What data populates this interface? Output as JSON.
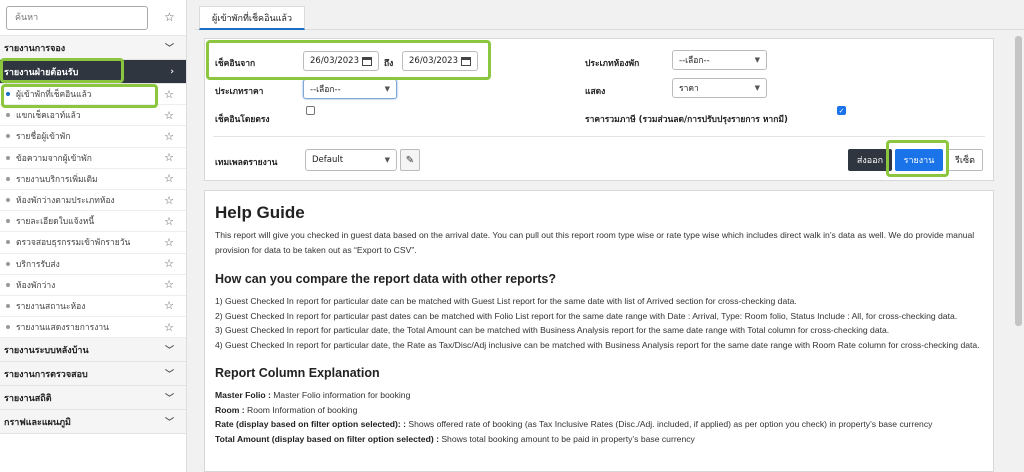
{
  "search": {
    "placeholder": "ค้นหา"
  },
  "sidebar": {
    "sections_top": [
      {
        "label": "รายงานการจอง"
      },
      {
        "label": "รายงานฝ่ายต้อนรับ"
      }
    ],
    "items": [
      {
        "label": "ผู้เข้าพักที่เช็คอินแล้ว"
      },
      {
        "label": "แขกเช็คเอาท์แล้ว"
      },
      {
        "label": "รายชื่อผู้เข้าพัก"
      },
      {
        "label": "ข้อความจากผู้เข้าพัก"
      },
      {
        "label": "รายงานบริการเพิ่มเติม"
      },
      {
        "label": "ห้องพักว่างตามประเภทห้อง"
      },
      {
        "label": "รายละเอียดใบแจ้งหนี้"
      },
      {
        "label": "ตรวจสอบธุรกรรมเข้าพักรายวัน"
      },
      {
        "label": "บริการรับส่ง"
      },
      {
        "label": "ห้องพักว่าง"
      },
      {
        "label": "รายงานสถานะห้อง"
      },
      {
        "label": "รายงานแสดงรายการงาน"
      }
    ],
    "sections_bottom": [
      {
        "label": "รายงานระบบหลังบ้าน"
      },
      {
        "label": "รายงานการตรวจสอบ"
      },
      {
        "label": "รายงานสถิติ"
      },
      {
        "label": "กราฟและแผนภูมิ"
      }
    ]
  },
  "tab": {
    "label": "ผู้เข้าพักที่เช็คอินแล้ว"
  },
  "filters": {
    "checkin_from_label": "เช็คอินจาก",
    "date_from": "26/03/2023",
    "to_label": "ถึง",
    "date_to": "26/03/2023",
    "room_type_label": "ประเภทห้องพัก",
    "room_type_value": "--เลือก--",
    "rate_type_label": "ประเภทราคา",
    "rate_type_value": "--เลือก--",
    "show_label": "แสดง",
    "show_value": "ราคา",
    "direct_checkin_label": "เช็คอินโดยตรง",
    "direct_checkin_checked": false,
    "tax_inclusive_label": "ราคารวมภาษี (รวมส่วนลด/การปรับปรุงรายการ หากมี)",
    "tax_inclusive_checked": true,
    "template_label": "เทมเพลตรายงาน",
    "template_value": "Default"
  },
  "buttons": {
    "export": "ส่งออก",
    "report": "รายงาน",
    "reset": "รีเซ็ต"
  },
  "help": {
    "title": "Help Guide",
    "intro": "This report will give you checked in guest data based on the arrival date. You can pull out this report room type wise or rate type wise which includes direct walk in’s data as well. We do provide manual provision for data to be taken out as “Export to CSV”.",
    "compare_heading": "How can you compare the report data with other reports?",
    "compare_items": [
      "1) Guest Checked In report for particular date can be matched with Guest List report for the same date with list of Arrived section for cross-checking data.",
      "2) Guest Checked In report for particular past dates can be matched with Folio List report for the same date range with Date : Arrival, Type: Room folio, Status Include : All, for cross-checking data.",
      "3) Guest Checked In report for particular date, the Total Amount can be matched with Business Analysis report for the same date range with Total column for cross-checking data.",
      "4) Guest Checked In report for particular date, the Rate as Tax/Disc/Adj inclusive can be matched with Business Analysis report for the same date range with Room Rate column for cross-checking data."
    ],
    "columns_heading": "Report Column Explanation",
    "columns": [
      {
        "name": "Master Folio :",
        "desc": " Master Folio information for booking"
      },
      {
        "name": "Room :",
        "desc": " Room Information of booking"
      },
      {
        "name": "Rate (display based on filter option selected): :",
        "desc": " Shows offered rate of booking (as Tax Inclusive Rates (Disc./Adj. included, if applied) as per option you check) in property’s base currency"
      },
      {
        "name": "Total Amount (display based on filter option selected) :",
        "desc": " Shows total booking amount to be paid in property’s base currency"
      }
    ]
  }
}
